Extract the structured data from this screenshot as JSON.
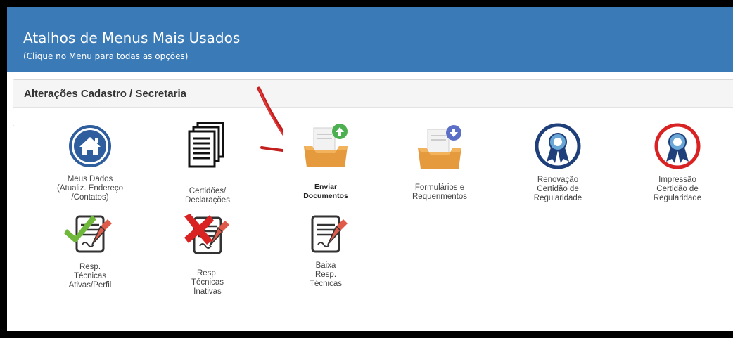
{
  "header": {
    "title": "Atalhos de Menus Mais Usados",
    "subtitle": "(Clique no Menu para todas as opções)"
  },
  "panel": {
    "title": "Alterações Cadastro / Secretaria"
  },
  "tiles": [
    {
      "lines": [
        "Meus Dados",
        "(Atualiz. Endereço",
        "/Contatos)"
      ],
      "icon": "home-icon"
    },
    {
      "lines": [
        "Certidões/",
        "Declarações"
      ],
      "icon": "documents-icon"
    },
    {
      "lines": [
        "Enviar",
        "Documentos"
      ],
      "icon": "upload-tray-icon"
    },
    {
      "lines": [
        "Formulários e",
        "Requerimentos"
      ],
      "icon": "download-tray-icon"
    },
    {
      "lines": [
        "Renovação",
        "Certidão de",
        "Regularidade"
      ],
      "icon": "ribbon-badge-icon"
    },
    {
      "lines": [
        "Impressão",
        "Certidão de",
        "Regularidade"
      ],
      "icon": "ribbon-badge-red-icon"
    },
    {
      "lines": [
        "Resp.",
        "Técnicas",
        "Ativas/Perfil"
      ],
      "icon": "contract-check-icon"
    },
    {
      "lines": [
        "Resp.",
        "Técnicas",
        "Inativas"
      ],
      "icon": "contract-x-icon"
    },
    {
      "lines": [
        "Baixa",
        "Resp.",
        "Técnicas"
      ],
      "icon": "contract-icon"
    }
  ],
  "colors": {
    "header": "#3a7ab7",
    "accent_red": "#d92323",
    "icon_blue": "#2f5e9e",
    "tray_orange": "#e59a3d"
  }
}
